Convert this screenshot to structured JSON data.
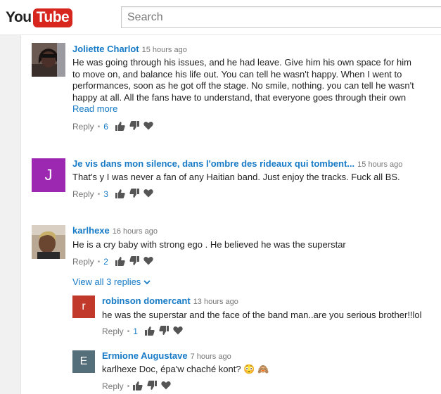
{
  "header": {
    "logo_you": "You",
    "logo_tube": "Tube",
    "search_placeholder": "Search"
  },
  "colors": {
    "link": "#167ac6",
    "logo_red": "#d7261d",
    "muted": "#767676"
  },
  "comments": [
    {
      "author": "Joliette Charlot",
      "time": "15 hours ago",
      "text": "He was going through his issues, and he had leave. Give him his own space for him to move on, and balance his life out. You can tell he wasn't happy. When I went to performances, soon as he got off the stage. No smile, nothing. you can tell he wasn't happy at all. All the fans have to understand, that everyone goes through their own",
      "read_more": "Read more",
      "reply": "Reply",
      "likes": "6"
    },
    {
      "author": "Je vis dans mon silence, dans l'ombre des rideaux qui tombent...",
      "time": "15 hours ago",
      "avatar_letter": "J",
      "avatar_color": "#9c27b0",
      "text": "That's y I was never a fan of any Haitian band. Just enjoy the tracks.  Fuck all BS.",
      "reply": "Reply",
      "likes": "3"
    },
    {
      "author": "karlhexe",
      "time": "16 hours ago",
      "text": "He is a cry  baby with strong ego . He believed he was the superstar",
      "reply": "Reply",
      "likes": "2",
      "view_all": "View all 3 replies"
    }
  ],
  "replies": [
    {
      "author": "robinson domercant",
      "time": "13 hours ago",
      "avatar_letter": "r",
      "avatar_color": "#c0392b",
      "text": "he was the superstar and the face of the band man..are you serious brother!!lol",
      "reply": "Reply",
      "likes": "1"
    },
    {
      "author": "Ermione Augustave",
      "time": "7 hours ago",
      "avatar_letter": "E",
      "avatar_color": "#546e7a",
      "text": "karlhexe Doc, épa'w chaché kont? 😳 🙈",
      "reply": "Reply"
    }
  ]
}
